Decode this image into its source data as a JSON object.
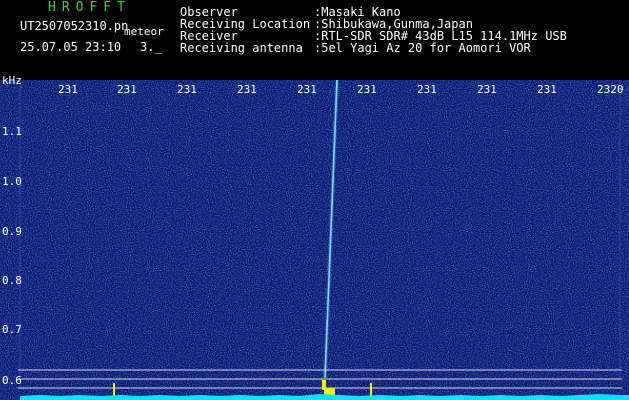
{
  "header": {
    "logo": "HROFFT",
    "filename": "UT2507052310.pn",
    "label": "meteor",
    "datetime": "25.07.05 23:10",
    "count": "3._"
  },
  "info": {
    "observer_label": "Observer",
    "observer_value": ":Masaki Kano",
    "location_label": "Receiving Location",
    "location_value": ":Shibukawa,Gunma,Japan",
    "receiver_label": "Receiver",
    "receiver_value": ":RTL-SDR SDR# 43dB L15 114.1MHz USB",
    "antenna_label": "Receiving antenna",
    "antenna_value": ":5el Yagi Az 20 for Aomori VOR"
  },
  "x_axis": {
    "ticks": [
      "231",
      "231",
      "231",
      "231",
      "231",
      "231",
      "231",
      "231",
      "231",
      "2320"
    ]
  },
  "y_axis": {
    "unit": "kHz",
    "ticks": [
      "1.1",
      "1.0",
      "0.9",
      "0.8",
      "0.7",
      "0.6"
    ]
  },
  "colors": {
    "background": "#000000",
    "spectrogram": "#0a1a6e",
    "noise": "#2e4cd8",
    "trail": "#8fe8ff",
    "baseline": "#10e0ff",
    "marker": "#f0f000",
    "logo": "#3cd23c"
  }
}
